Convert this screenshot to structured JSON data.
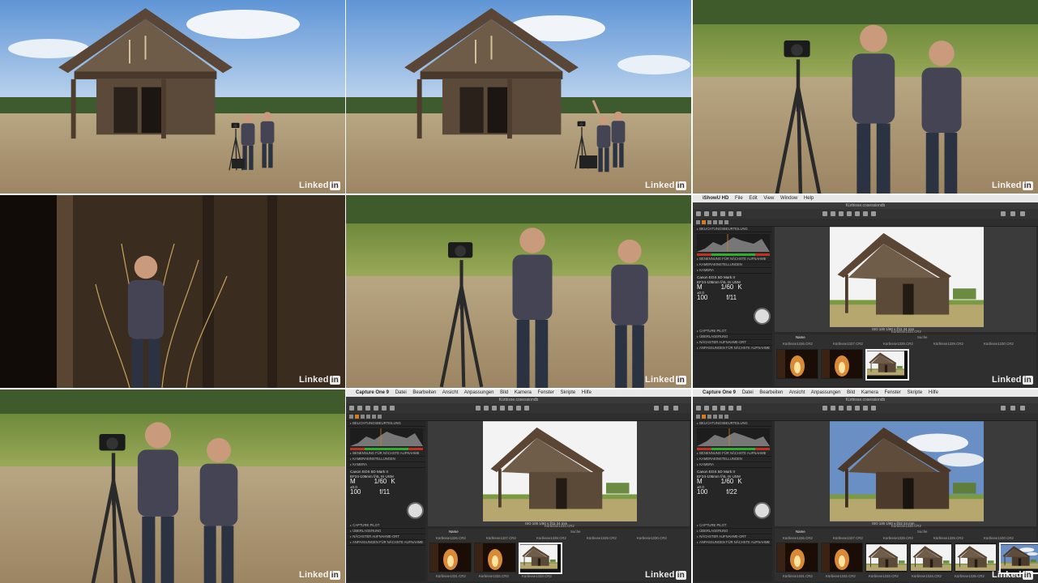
{
  "watermark": "Linked",
  "watermark_box": "in",
  "capture_a": {
    "menu": [
      "iShowU HD",
      "File",
      "Edit",
      "View",
      "Window",
      "Help"
    ],
    "session": "Kürbisse.cosessiondb",
    "sections": [
      "BELICHTUNGSBEURTEILUNG",
      "BENENNUNG FÜR NÄCHSTE AUFNAHME",
      "KAMERAEINSTELLUNGEN",
      "KAMERA"
    ],
    "camera_model": "Canon EOS 5D Mark II",
    "lens": "EF24-105mm f/4L IS USM",
    "mode": "M",
    "shutter": "1/60",
    "ev": "±0.0",
    "iso": "100",
    "aperture": "f/11",
    "k_label": "K",
    "bottom_sections": [
      "CAPTURE PILOT",
      "ÜBERLAGERUNG",
      "NÄCHSTER AUFNAHME-ORT",
      "ANPASSUNGEN FÜR NÄCHSTE AUFNAHME"
    ],
    "info_bar": "ISO 100   1/60 s   f/11   24 mm",
    "caption": "Kürbisse1333.CR2",
    "name_col": "Name",
    "search": "Suche",
    "files": [
      "Kürbisse1326.CR2",
      "Kürbisse1327.CR2",
      "Kürbisse1328.CR2",
      "Kürbisse1329.CR2",
      "Kürbisse1330.CR2"
    ]
  },
  "capture_b": {
    "menu": [
      "Capture One 9",
      "Datei",
      "Bearbeiten",
      "Ansicht",
      "Anpassungen",
      "Bild",
      "Kamera",
      "Fenster",
      "Skripte",
      "Hilfe"
    ],
    "session": "Kürbisse.cosessiondb",
    "sections": [
      "BELICHTUNGSBEURTEILUNG",
      "BENENNUNG FÜR NÄCHSTE AUFNAHME",
      "KAMERAEINSTELLUNGEN",
      "KAMERA"
    ],
    "camera_model": "Canon EOS 5D Mark II",
    "lens": "EF24-105mm f/4L IS USM",
    "mode": "M",
    "shutter": "1/60",
    "ev": "±0.0",
    "iso": "100",
    "aperture": "f/11",
    "k_label": "K",
    "bottom_sections": [
      "CAPTURE PILOT",
      "ÜBERLAGERUNG",
      "NÄCHSTER AUFNAHME-ORT",
      "ANPASSUNGEN FÜR NÄCHSTE AUFNAHME"
    ],
    "info_bar": "ISO 100   1/60 s   f/11   24 mm",
    "caption": "Kürbisse1333.CR2",
    "name_col": "Name",
    "search": "Suche",
    "files": [
      "Kürbisse1326.CR2",
      "Kürbisse1327.CR2",
      "Kürbisse1328.CR2",
      "Kürbisse1329.CR2",
      "Kürbisse1330.CR2"
    ],
    "thumb_names": [
      "Kürbisse1331.CR2",
      "Kürbisse1332.CR2",
      "Kürbisse1333.CR2"
    ]
  },
  "capture_c": {
    "menu": [
      "Capture One 9",
      "Datei",
      "Bearbeiten",
      "Ansicht",
      "Anpassungen",
      "Bild",
      "Kamera",
      "Fenster",
      "Skripte",
      "Hilfe"
    ],
    "session": "Kürbisse.cosessiondb",
    "sections": [
      "BELICHTUNGSBEURTEILUNG",
      "BENENNUNG FÜR NÄCHSTE AUFNAHME",
      "KAMERAEINSTELLUNGEN",
      "KAMERA"
    ],
    "camera_model": "Canon EOS 5D Mark II",
    "lens": "EF24-105mm f/4L IS USM",
    "mode": "M",
    "shutter": "1/60",
    "ev": "±0.0",
    "iso": "100",
    "aperture": "f/22",
    "k_label": "K",
    "bottom_sections": [
      "CAPTURE PILOT",
      "ÜBERLAGERUNG",
      "NÄCHSTER AUFNAHME-ORT",
      "ANPASSUNGEN FÜR NÄCHSTE AUFNAHME"
    ],
    "info_bar": "ISO 100   1/60 s   f/22   24 mm",
    "caption": "Kürbisse1336.CR2",
    "name_col": "Name",
    "search": "Suche",
    "files": [
      "Kürbisse1326.CR2",
      "Kürbisse1327.CR2",
      "Kürbisse1328.CR2",
      "Kürbisse1329.CR2",
      "Kürbisse1330.CR2"
    ],
    "thumb_names": [
      "Kürbisse1331.CR2",
      "Kürbisse1332.CR2",
      "Kürbisse1333.CR2",
      "Kürbisse1334.CR2",
      "Kürbisse1335.CR2",
      "Kürbisse1336.CR2"
    ]
  }
}
